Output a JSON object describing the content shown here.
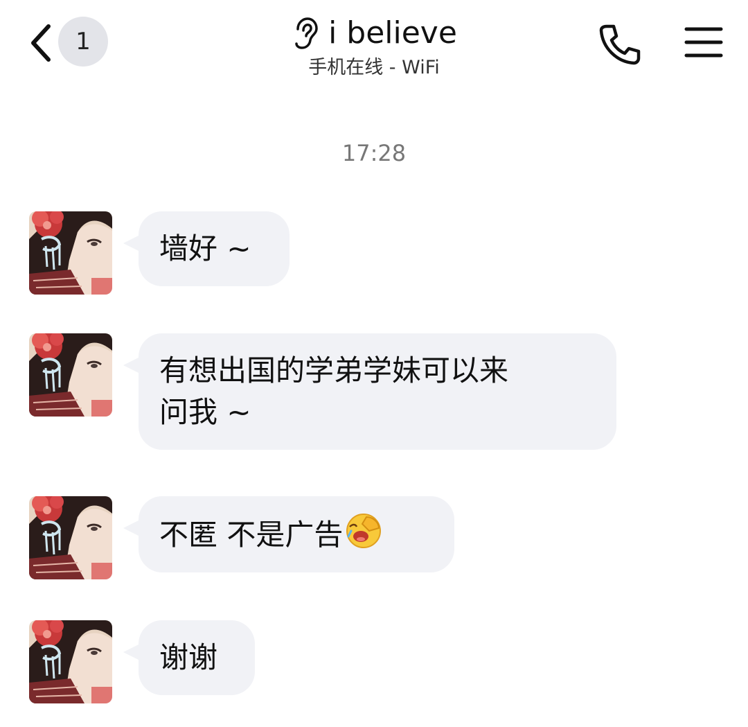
{
  "header": {
    "unread_count": "1",
    "contact_name": "i believe",
    "contact_status": "手机在线 - WiFi",
    "icons": [
      "back-chevron-icon",
      "ear-icon",
      "phone-icon",
      "menu-icon"
    ]
  },
  "conversation": {
    "timestamp": "17:28",
    "messages": [
      {
        "text": "墙好 ~"
      },
      {
        "text": "有想出国的学弟学妹可以来\n问我 ~"
      },
      {
        "text": "不匿 不是广告",
        "emoji": "facepalm-laugh-emoji"
      },
      {
        "text": "谢谢"
      }
    ]
  },
  "colors": {
    "background": "#ffffff",
    "bubble": "#f1f2f6",
    "badge": "#e3e4e9",
    "timestamp": "#777777",
    "text": "#111111"
  }
}
